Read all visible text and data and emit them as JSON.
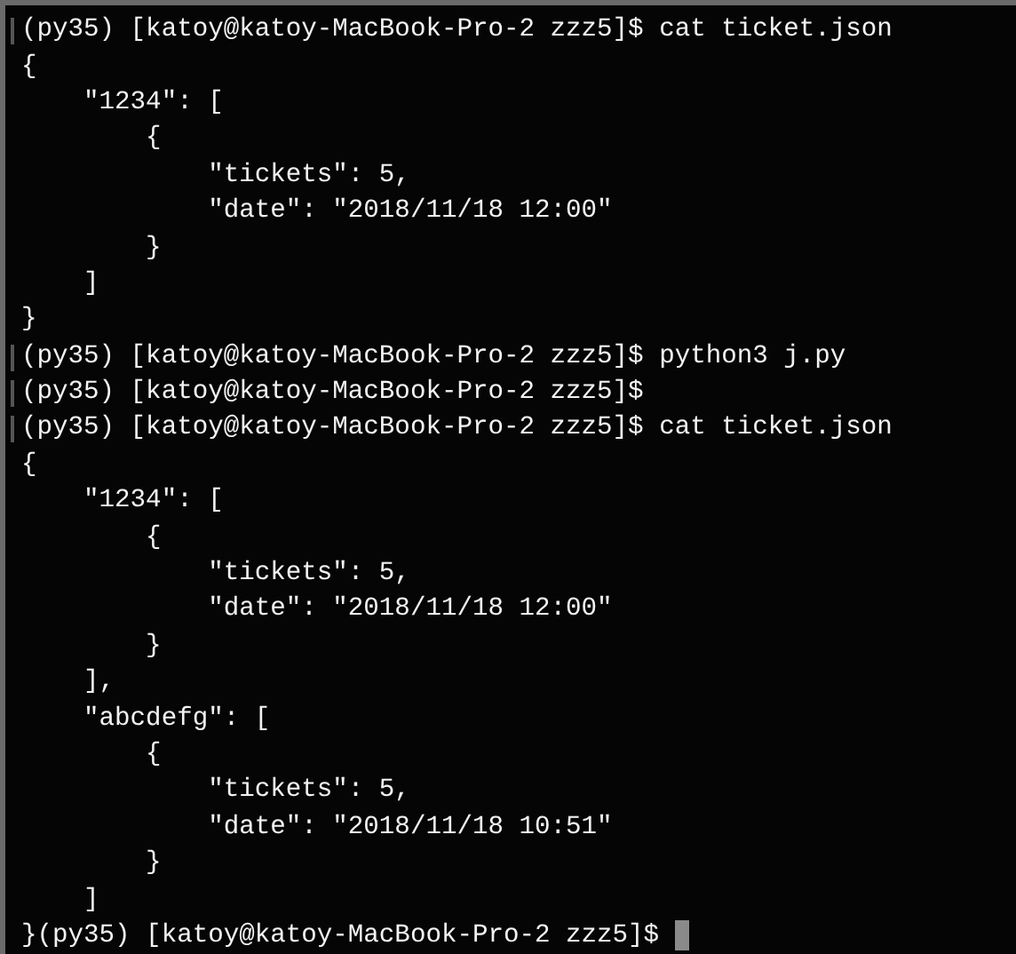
{
  "terminal": {
    "cursor_visible": true,
    "lines": [
      {
        "kind": "prompt",
        "text": "(py35) [katoy@katoy-MacBook-Pro-2 zzz5]$ cat ticket.json"
      },
      {
        "kind": "output",
        "text": "{"
      },
      {
        "kind": "output",
        "text": "    \"1234\": ["
      },
      {
        "kind": "output",
        "text": "        {"
      },
      {
        "kind": "output",
        "text": "            \"tickets\": 5,"
      },
      {
        "kind": "output",
        "text": "            \"date\": \"2018/11/18 12:00\""
      },
      {
        "kind": "output",
        "text": "        }"
      },
      {
        "kind": "output",
        "text": "    ]"
      },
      {
        "kind": "output",
        "text": "}"
      },
      {
        "kind": "prompt",
        "text": "(py35) [katoy@katoy-MacBook-Pro-2 zzz5]$ python3 j.py"
      },
      {
        "kind": "prompt",
        "text": "(py35) [katoy@katoy-MacBook-Pro-2 zzz5]$"
      },
      {
        "kind": "prompt",
        "text": "(py35) [katoy@katoy-MacBook-Pro-2 zzz5]$ cat ticket.json"
      },
      {
        "kind": "output",
        "text": "{"
      },
      {
        "kind": "output",
        "text": "    \"1234\": ["
      },
      {
        "kind": "output",
        "text": "        {"
      },
      {
        "kind": "output",
        "text": "            \"tickets\": 5,"
      },
      {
        "kind": "output",
        "text": "            \"date\": \"2018/11/18 12:00\""
      },
      {
        "kind": "output",
        "text": "        }"
      },
      {
        "kind": "output",
        "text": "    ],"
      },
      {
        "kind": "output",
        "text": "    \"abcdefg\": ["
      },
      {
        "kind": "output",
        "text": "        {"
      },
      {
        "kind": "output",
        "text": "            \"tickets\": 5,"
      },
      {
        "kind": "output",
        "text": "            \"date\": \"2018/11/18 10:51\""
      },
      {
        "kind": "output",
        "text": "        }"
      },
      {
        "kind": "output",
        "text": "    ]"
      },
      {
        "kind": "output",
        "text": "}(py35) [katoy@katoy-MacBook-Pro-2 zzz5]$"
      }
    ]
  }
}
